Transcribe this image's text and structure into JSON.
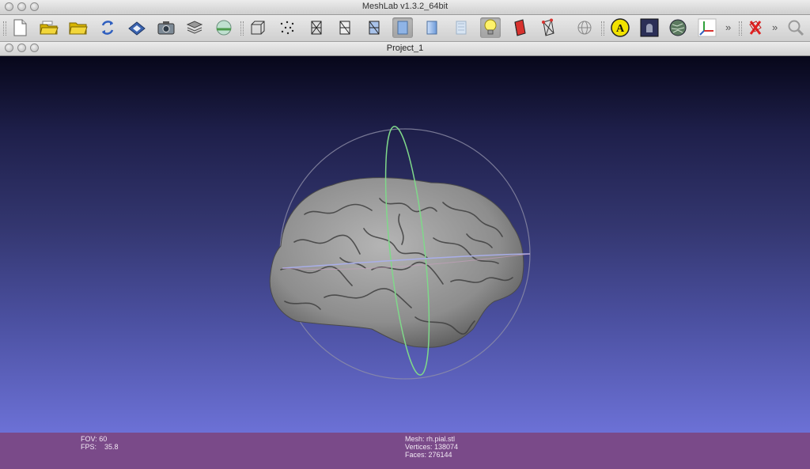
{
  "app": {
    "window_title": "MeshLab v1.3.2_64bit"
  },
  "document": {
    "title": "Project_1"
  },
  "toolbar": {
    "overflow_1": "»",
    "overflow_2": "»",
    "annotate_letter": "A"
  },
  "viewport": {
    "bg_top": "#07071a",
    "bg_bottom": "#6c71d6",
    "mesh_color": "#9a9a9a"
  },
  "status": {
    "fov_label": "FOV:",
    "fov_value": "60",
    "fps_label": "FPS:",
    "fps_value": "35.8",
    "mesh_label": "Mesh:",
    "mesh_value": "rh.pial.stl",
    "vertices_label": "Vertices:",
    "vertices_value": "138074",
    "faces_label": "Faces:",
    "faces_value": "276144"
  },
  "colors": {
    "info_bar": "#7a4a89",
    "text": "#f2e8f4"
  }
}
